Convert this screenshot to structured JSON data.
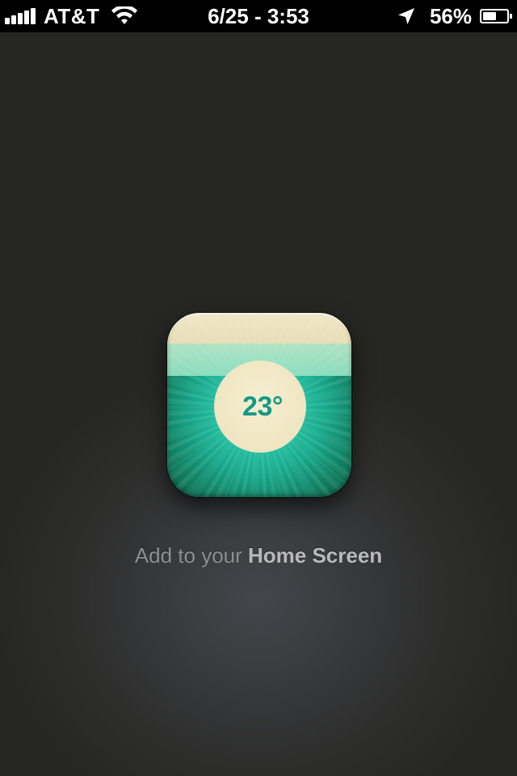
{
  "status_bar": {
    "carrier": "AT&T",
    "datetime": "6/25 - 3:53",
    "battery_percent_label": "56%",
    "battery_level": 0.56,
    "signal_bars": 5
  },
  "app_icon": {
    "temperature": "23°"
  },
  "caption": {
    "prefix": "Add to your ",
    "emphasis": "Home Screen"
  },
  "colors": {
    "background": "#262624",
    "icon_teal": "#27c6a8",
    "icon_text": "#159a86",
    "caption_text": "#8e8f90"
  }
}
